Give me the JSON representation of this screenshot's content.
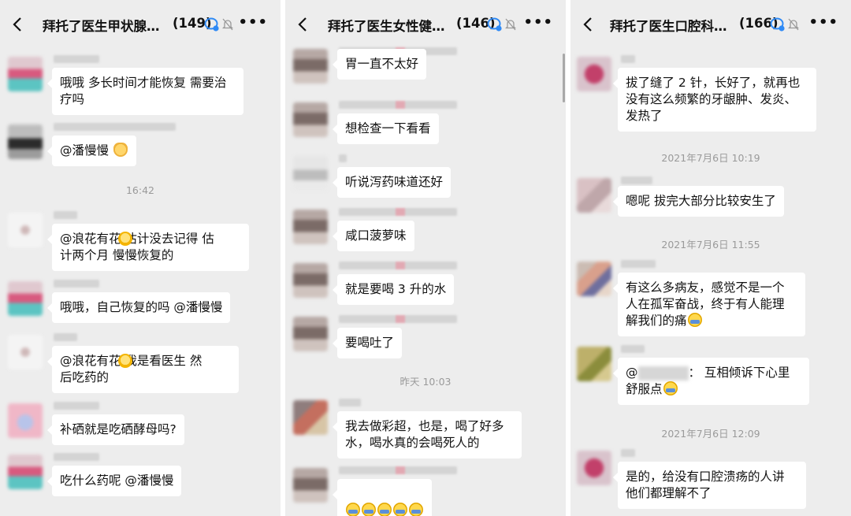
{
  "panels": [
    {
      "title": "拜托了医生甲状腺…",
      "count": "(149)",
      "messages": [
        {
          "text": "哦哦 多长时间才能恢复 需要治\n疗吗"
        },
        {
          "text": "@潘慢慢 "
        },
        {
          "text": "@浪花有花 估计没去记得 估\n计两个月  慢慢恢复的"
        },
        {
          "text": "哦哦，自己恢复的吗 @潘慢慢"
        },
        {
          "text": "@浪花有花 我是看医生  然\n后吃药的"
        },
        {
          "text": "补硒就是吃硒酵母吗?"
        },
        {
          "text": "吃什么药呢 @潘慢慢"
        }
      ],
      "timestamps": [
        "16:42"
      ]
    },
    {
      "title": "拜托了医生女性健…",
      "count": "(146)",
      "messages": [
        {
          "text": "胃一直不太好"
        },
        {
          "text": "想检查一下看看"
        },
        {
          "text": "听说泻药味道还好"
        },
        {
          "text": "咸口菠萝味"
        },
        {
          "text": "就是要喝 3 升的水"
        },
        {
          "text": "要喝吐了"
        },
        {
          "text": "我去做彩超，也是，喝了好多\n水，喝水真的会喝死人的"
        },
        {
          "text": ""
        }
      ],
      "timestamps": [
        "昨天 10:03"
      ]
    },
    {
      "title": "拜托了医生口腔科…",
      "count": "(166)",
      "messages": [
        {
          "text": "拔了缝了 2 针，长好了，就再也\n没有这么频繁的牙龈肿、发炎、\n发热了"
        },
        {
          "text": "嗯呢 拔完大部分比较安生了"
        },
        {
          "text": "有这么多病友，感觉不是一个\n人在孤军奋战，终于有人能理\n解我们的痛"
        },
        {
          "text_prefix": "@",
          "text": "：  互相倾诉下心里\n舒服点"
        },
        {
          "text": "是的，给没有口腔溃疡的人讲\n他们都理解不了"
        }
      ],
      "timestamps": [
        "2021年7月6日 10:19",
        "2021年7月6日 11:55",
        "2021年7月6日 12:09"
      ]
    }
  ],
  "icons": {
    "back": "chevron-left-icon",
    "group": "group-chat-icon",
    "mute": "mute-bell-icon",
    "more": "more-icon"
  },
  "colors": {
    "bg": "#ededed",
    "bubble": "#ffffff",
    "timestamp": "#9a9a9a"
  }
}
